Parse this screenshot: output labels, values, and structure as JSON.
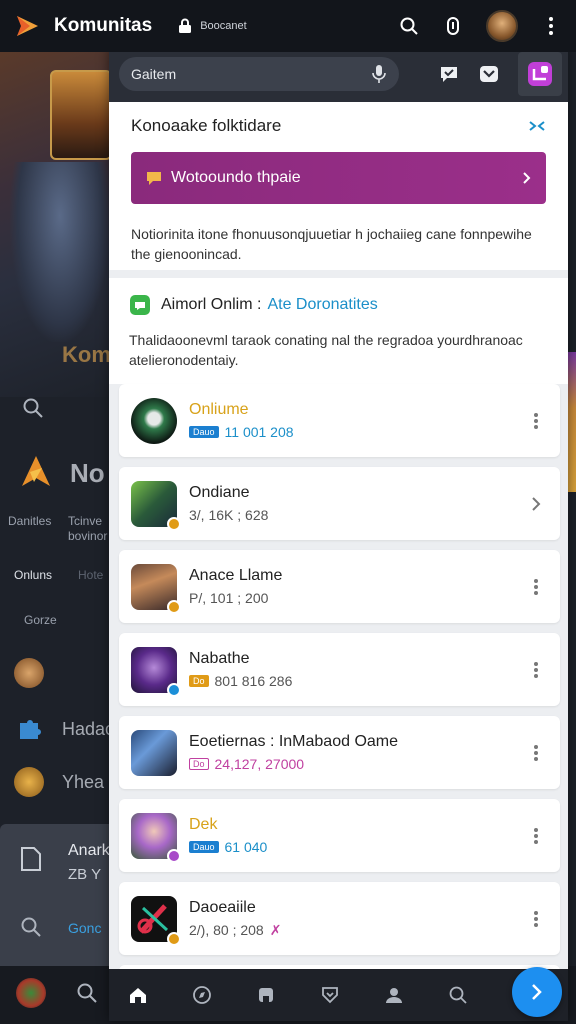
{
  "app": {
    "title": "Komunitas",
    "lock_label": "Boocanet"
  },
  "panel": {
    "search_placeholder": "Gaitem",
    "intro_title": "Konoaake folktidare",
    "banner_text": "Wotooundo thpaie",
    "intro_desc": "Notiorinita itone fhonuusonqjuuetiar h jochaiieg cane fonnpewihe the gienoonincad.",
    "online_title": "Aimorl Onlim :",
    "online_link": "Ate Doronatites",
    "online_desc": "Thalidaoonevml taraok conating nal the regradoa yourdhranoac atelieronodentaiy."
  },
  "items": [
    {
      "name": "Onliume",
      "name_color": "#d8a21a",
      "chip": "Dauo",
      "chip_style": "solid",
      "chip_color": "#1b7fd0",
      "meta": "11 001 208",
      "meta_color": "#1b8fc9",
      "action": "more"
    },
    {
      "name": "Ondiane",
      "chip": "",
      "meta": "3/, 16K ; 628",
      "meta_color": "#555555",
      "action": "chevron"
    },
    {
      "name": "Anace Llame",
      "chip": "",
      "meta": "P/, 101 ; 200",
      "meta_color": "#555555",
      "action": "more"
    },
    {
      "name": "Nabathe",
      "chip": "Do",
      "chip_style": "solid",
      "chip_color": "#e09b17",
      "meta": "801 816 286",
      "meta_color": "#555555",
      "action": "more"
    },
    {
      "name": "Eoetiernas : InMabaod Oame",
      "chip": "Do",
      "chip_style": "outline",
      "chip_color": "#c040a0",
      "meta": "24,127, 27000",
      "meta_color": "#c040a0",
      "action": "more"
    },
    {
      "name": "Dek",
      "name_color": "#d8a21a",
      "chip": "Dauo",
      "chip_style": "solid",
      "chip_color": "#1b7fd0",
      "meta": "61 040",
      "meta_color": "#1b8fc9",
      "action": "more"
    },
    {
      "name": "Daoeaiile",
      "chip": "",
      "meta": "2/), 80 ; 208",
      "meta_color": "#555555",
      "action": "more"
    }
  ],
  "background": {
    "hero_text": "Kom",
    "title": "No",
    "labels": [
      "Danitles",
      "Tcinve\nbovinor",
      "Onluns",
      "Hote",
      "Gorze"
    ],
    "row1": "Hadac",
    "row2": "Yhea",
    "sheet_title": "Anark",
    "sheet_sub": "ZB Y",
    "sheet_link": "Gonc"
  },
  "colors": {
    "accent": "#9b2f8a",
    "link": "#1b8fc9",
    "fab": "#1d8ff0"
  }
}
